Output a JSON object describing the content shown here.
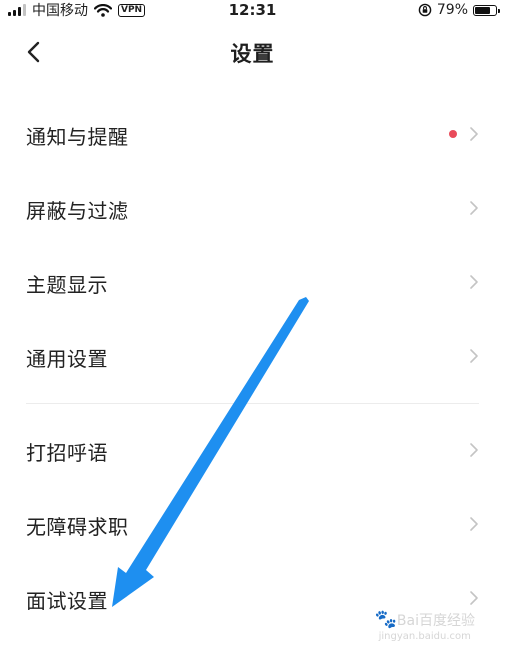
{
  "status_bar": {
    "carrier": "中国移动",
    "vpn": "VPN",
    "time": "12:31",
    "battery": "79%",
    "battery_level": 0.79
  },
  "nav": {
    "title": "设置",
    "back_icon": "chevron-left-icon"
  },
  "settings_groups": [
    [
      {
        "label": "通知与提醒",
        "has_dot": true
      },
      {
        "label": "屏蔽与过滤"
      },
      {
        "label": "主题显示"
      },
      {
        "label": "通用设置"
      }
    ],
    [
      {
        "label": "打招呼语"
      },
      {
        "label": "无障碍求职"
      },
      {
        "label": "面试设置"
      }
    ]
  ],
  "colors": {
    "notification_dot": "#e94b5a",
    "chevron": "#c4c4c4",
    "annotation_arrow": "#1e8ff0"
  },
  "watermark": {
    "brand": "Bai百度经验",
    "url": "jingyan.baidu.com"
  }
}
